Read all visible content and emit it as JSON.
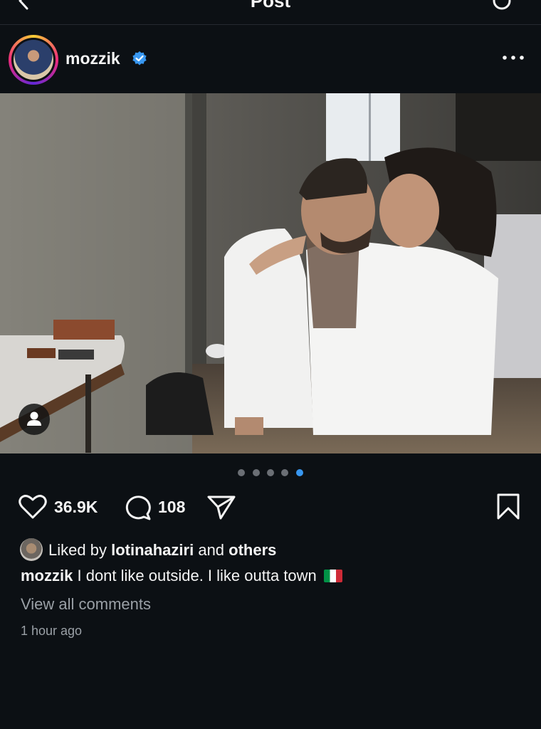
{
  "topbar": {
    "title": "Post",
    "back_icon": "chevron-left-icon",
    "refresh_icon": "refresh-icon"
  },
  "post": {
    "username": "mozzik",
    "verified": true,
    "more_icon": "more-horizontal-icon",
    "carousel": {
      "count": 5,
      "active_index": 4
    },
    "likes_count": "36.9K",
    "comments_count": "108",
    "liked_by_prefix": "Liked by",
    "liked_by_user": "lotinahaziri",
    "liked_by_and": "and",
    "liked_by_others": "others",
    "caption_user": "mozzik",
    "caption_text": "I dont like outside. I like outta town",
    "caption_emoji": "italy-flag",
    "view_all_comments": "View all comments",
    "timestamp": "1 hour ago"
  },
  "colors": {
    "background": "#0c1014",
    "text": "#f5f5f5",
    "muted": "#9aa0a6",
    "accent": "#3897f0"
  }
}
